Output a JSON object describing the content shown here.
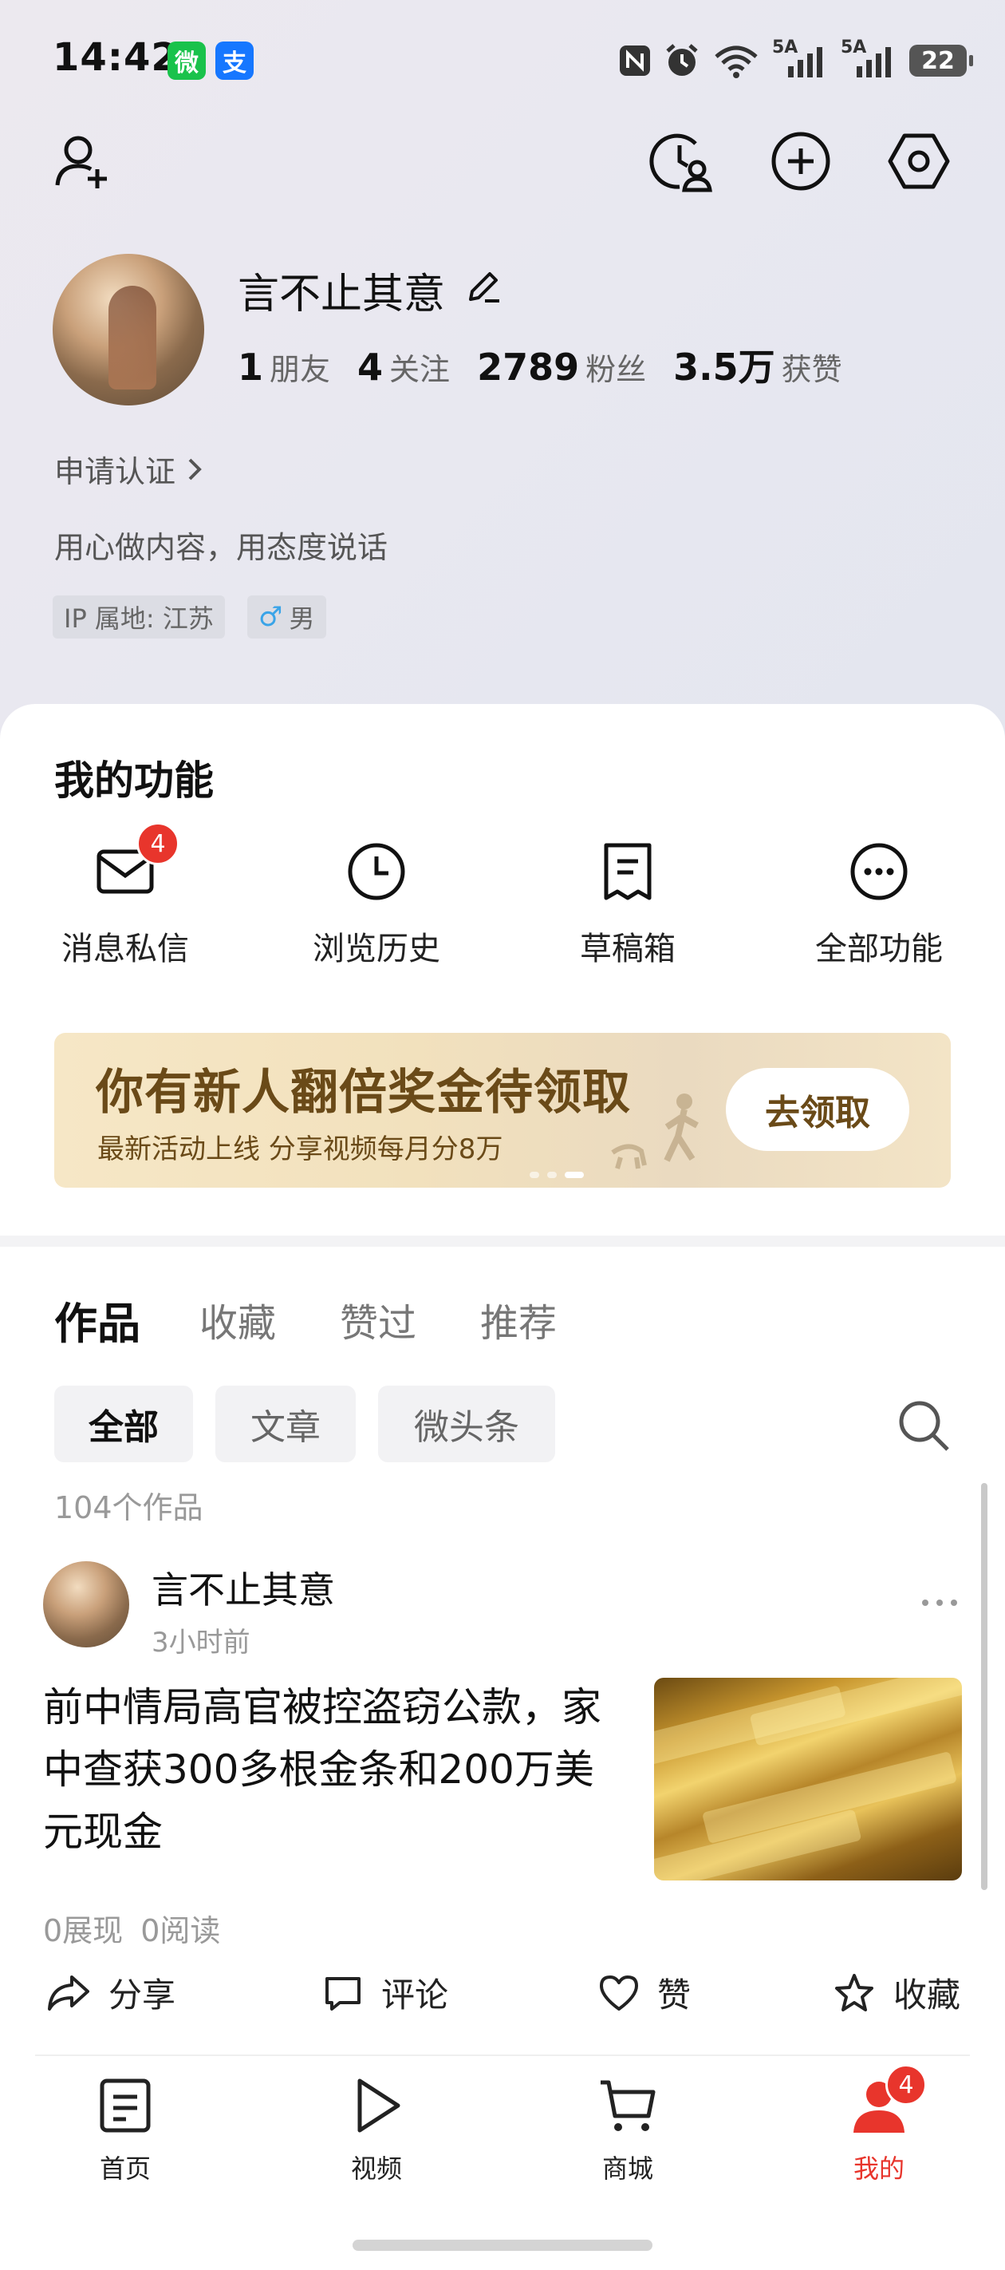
{
  "status_bar": {
    "time": "14:42",
    "wechat_glyph": "微",
    "alipay_glyph": "支",
    "net1": "5A",
    "net2": "5A",
    "battery": "22"
  },
  "profile": {
    "username": "言不止其意",
    "stats": [
      {
        "num": "1",
        "label": "朋友"
      },
      {
        "num": "4",
        "label": "关注"
      },
      {
        "num": "2789",
        "label": "粉丝"
      },
      {
        "num": "3.5万",
        "label": "获赞"
      }
    ],
    "verify": "申请认证",
    "bio": "用心做内容，用态度说话",
    "ip_tag": "IP 属地: 江苏",
    "gender_tag": "男",
    "gender_symbol": "♂"
  },
  "functions": {
    "title": "我的功能",
    "items": [
      {
        "label": "消息私信",
        "badge": "4"
      },
      {
        "label": "浏览历史"
      },
      {
        "label": "草稿箱"
      },
      {
        "label": "全部功能"
      }
    ]
  },
  "banner": {
    "title": "你有新人翻倍奖金待领取",
    "subtitle": "最新活动上线 分享视频每月分8万",
    "button": "去领取"
  },
  "tabs": [
    "作品",
    "收藏",
    "赞过",
    "推荐"
  ],
  "filters": [
    "全部",
    "文章",
    "微头条"
  ],
  "works_count": "104个作品",
  "post": {
    "author": "言不止其意",
    "time": "3小时前",
    "title": "前中情局高官被控盗窃公款，家中查获300多根金条和200万美元现金",
    "views": "0展现",
    "reads": "0阅读",
    "actions": [
      "分享",
      "评论",
      "赞",
      "收藏"
    ]
  },
  "bottom_nav": {
    "items": [
      {
        "label": "首页"
      },
      {
        "label": "视频"
      },
      {
        "label": "商城"
      },
      {
        "label": "我的",
        "badge": "4"
      }
    ],
    "active_color": "#e8352c"
  }
}
